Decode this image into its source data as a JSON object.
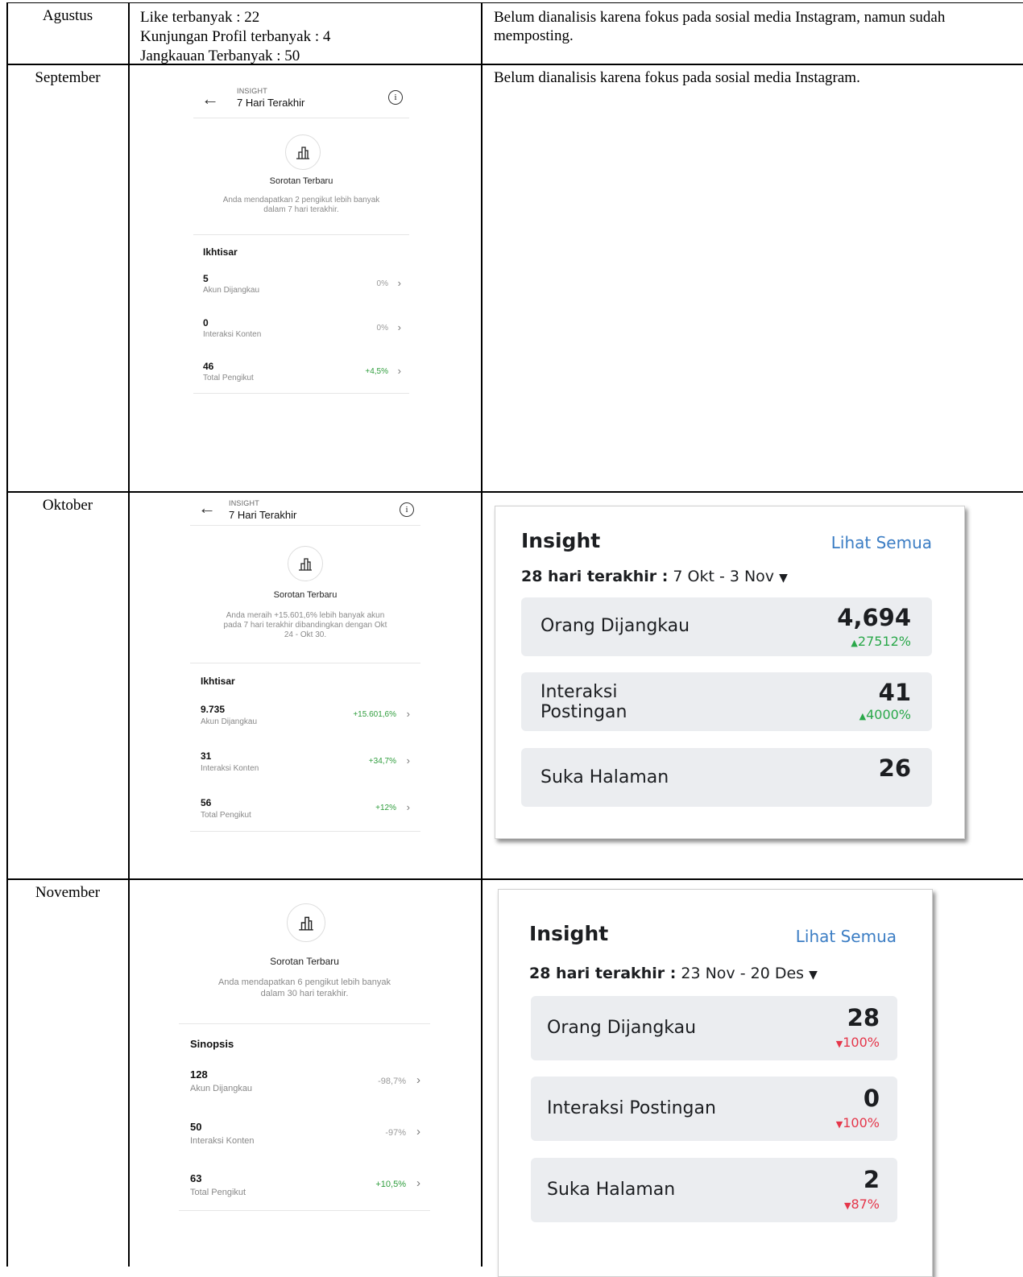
{
  "rows": [
    {
      "month": "Agustus",
      "col2": [
        "Like terbanyak : 22",
        "Kunjungan Profil terbanyak : 4",
        "Jangkauan Terbanyak : 50"
      ],
      "col3": "Belum dianalisis karena fokus pada sosial media Instagram, namun sudah memposting."
    },
    {
      "month": "September",
      "col3": "Belum dianalisis karena fokus pada sosial media Instagram.",
      "instagram": {
        "header_sup": "INSIGHT",
        "header_title": "7 Hari Terakhir",
        "highlight_title": "Sorotan Terbaru",
        "highlight_desc": [
          "Anda mendapatkan 2 pengikut lebih banyak",
          "dalam 7 hari terakhir."
        ],
        "section": "Ikhtisar",
        "metrics": [
          {
            "value": "5",
            "label": "Akun Dijangkau",
            "change": "0%"
          },
          {
            "value": "0",
            "label": "Interaksi Konten",
            "change": "0%"
          },
          {
            "value": "46",
            "label": "Total Pengikut",
            "change": "+4,5%"
          }
        ]
      }
    },
    {
      "month": "Oktober",
      "instagram": {
        "header_sup": "INSIGHT",
        "header_title": "7 Hari Terakhir",
        "highlight_title": "Sorotan Terbaru",
        "highlight_desc": [
          "Anda meraih +15.601,6% lebih banyak akun",
          "pada 7 hari terakhir dibandingkan dengan Okt",
          "24 - Okt 30."
        ],
        "section": "Ikhtisar",
        "metrics": [
          {
            "value": "9.735",
            "label": "Akun Dijangkau",
            "change": "+15.601,6%"
          },
          {
            "value": "31",
            "label": "Interaksi Konten",
            "change": "+34,7%"
          },
          {
            "value": "56",
            "label": "Total Pengikut",
            "change": "+12%"
          }
        ]
      },
      "facebook": {
        "title": "Insight",
        "see_all": "Lihat Semua",
        "range_label": "28 hari terakhir :",
        "range_value": "7 Okt - 3 Nov",
        "cards": [
          {
            "label": [
              "Orang Dijangkau"
            ],
            "value": "4,694",
            "change": "27512%",
            "direction": "up"
          },
          {
            "label": [
              "Interaksi",
              "Postingan"
            ],
            "value": "41",
            "change": "4000%",
            "direction": "up"
          },
          {
            "label": [
              "Suka Halaman"
            ],
            "value": "26",
            "change": "",
            "direction": "none"
          }
        ]
      }
    },
    {
      "month": "November",
      "instagram": {
        "highlight_title": "Sorotan Terbaru",
        "highlight_desc": [
          "Anda mendapatkan 6 pengikut lebih banyak",
          "dalam 30 hari terakhir."
        ],
        "section": "Sinopsis",
        "metrics": [
          {
            "value": "128",
            "label": "Akun Dijangkau",
            "change": "-98,7%"
          },
          {
            "value": "50",
            "label": "Interaksi Konten",
            "change": "-97%"
          },
          {
            "value": "63",
            "label": "Total Pengikut",
            "change": "+10,5%"
          }
        ]
      },
      "facebook": {
        "title": "Insight",
        "see_all": "Lihat Semua",
        "range_label": "28 hari terakhir :",
        "range_value": "23 Nov - 20 Des",
        "cards": [
          {
            "label": [
              "Orang Dijangkau"
            ],
            "value": "28",
            "change": "100%",
            "direction": "down"
          },
          {
            "label": [
              "Interaksi Postingan"
            ],
            "value": "0",
            "change": "100%",
            "direction": "down"
          },
          {
            "label": [
              "Suka Halaman"
            ],
            "value": "2",
            "change": "87%",
            "direction": "down"
          }
        ]
      }
    }
  ],
  "colors": {
    "positive": "#2e9d3c",
    "fb_positive": "#2aa84a",
    "fb_negative": "#e5364a",
    "fb_link": "#3b7dc4",
    "fb_box": "#ebedf0"
  },
  "icons": [
    "back-arrow-icon",
    "info-icon",
    "bar-chart-icon",
    "chevron-right-icon",
    "triangle-up-icon",
    "triangle-down-icon",
    "dropdown-caret-icon"
  ]
}
